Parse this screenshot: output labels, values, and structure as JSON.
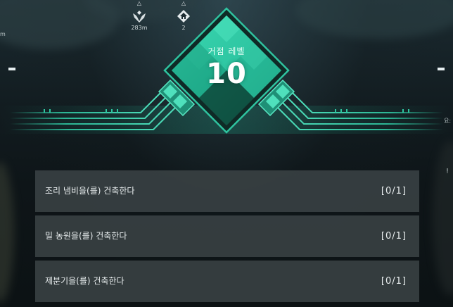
{
  "hud": {
    "distance_value": "283m",
    "count_value": "2",
    "left_edge_text": "m",
    "right_edge_text": "요:",
    "right_edge_mark": "!"
  },
  "level": {
    "label": "거점 레벨",
    "number": "10"
  },
  "tasks": [
    {
      "text": "조리 냄비을(를) 건축한다",
      "progress": "[0/1]"
    },
    {
      "text": "밀 농원을(를) 건축한다",
      "progress": "[0/1]"
    },
    {
      "text": "제분기을(를) 건축한다",
      "progress": "[0/1]"
    }
  ],
  "colors": {
    "accent": "#2fc4a0",
    "accent_bright": "#4fe0bc",
    "panel": "#3a4244",
    "text": "#e9eeef"
  },
  "icons": {
    "distance": "winged-badge-icon",
    "count": "home-icon"
  }
}
